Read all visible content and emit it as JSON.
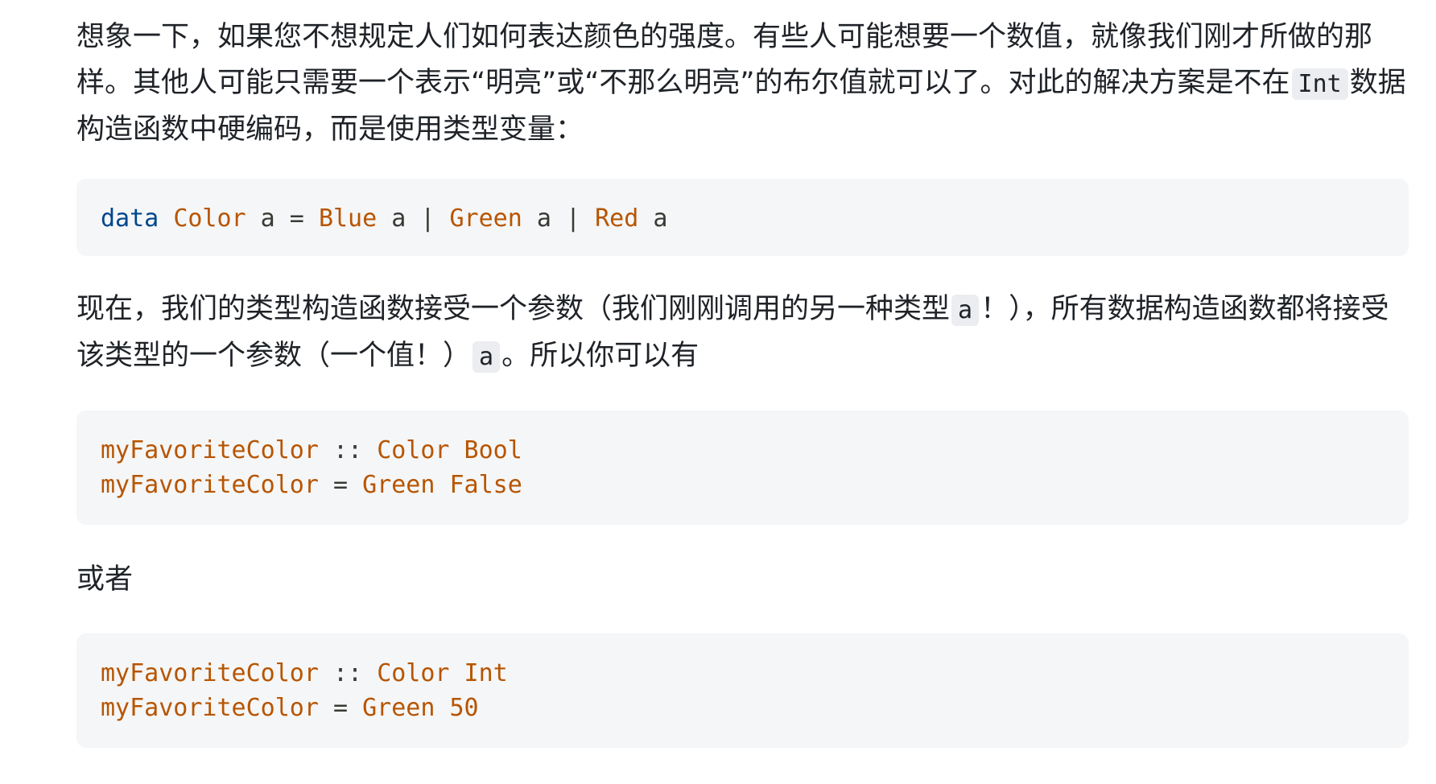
{
  "paragraphs": {
    "p1_line1": "想象一下，如果您不想规定人们如何表达颜色的强度。有些人可能想要一个数值，就像我们刚才所做的那样。其他人可能只需要一个表示“明亮”或“不那么明亮”的布尔值就可以了。对此的解决方案是不在",
    "p1_code": "Int",
    "p1_line2": "数据构造函数中硬编码，而是使用类型变量：",
    "p2_part1": "现在，我们的类型构造函数接受一个参数（我们刚刚调用的另一种类型",
    "p2_code1": "a",
    "p2_part2": "！），所有数据构造函数都将接受该类型的一个参数（一个值！）",
    "p2_code2": "a",
    "p2_part3": "。所以你可以有",
    "p3": "或者"
  },
  "code_blocks": {
    "block1": {
      "kw_data": "data",
      "type_name": "Color",
      "var_a1": " a = ",
      "ctor1": "Blue",
      "var_a2": " a | ",
      "ctor2": "Green",
      "var_a3": " a | ",
      "ctor3": "Red",
      "var_a4": " a"
    },
    "block2": {
      "l1_name": "myFavoriteColor",
      "l1_op": " :: ",
      "l1_type": "Color Bool",
      "l2_name": "myFavoriteColor",
      "l2_op": " = ",
      "l2_value": "Green False"
    },
    "block3": {
      "l1_name": "myFavoriteColor",
      "l1_op": " :: ",
      "l1_type": "Color Int",
      "l2_name": "myFavoriteColor",
      "l2_op": " = ",
      "l2_value": "Green 50"
    }
  },
  "colors": {
    "keyword": "#00468c",
    "type": "#b75501",
    "code_bg": "#f5f6f7",
    "text": "#1f2328"
  }
}
